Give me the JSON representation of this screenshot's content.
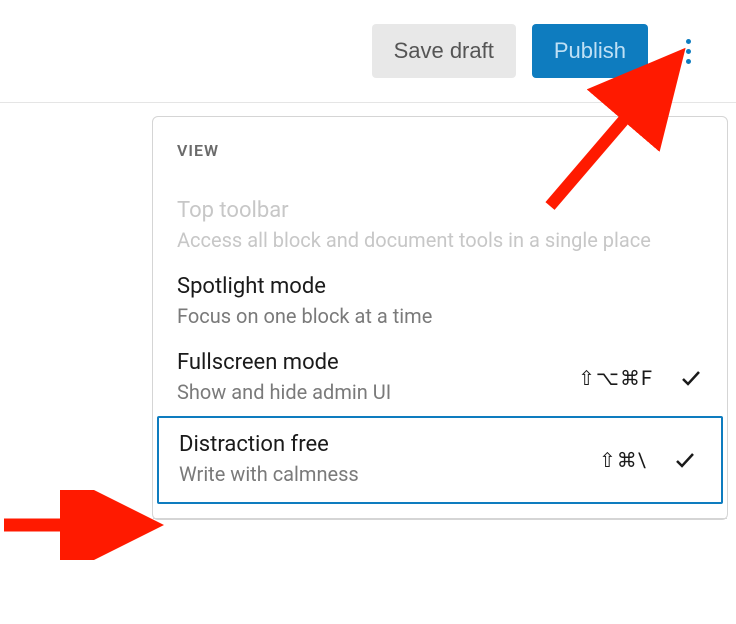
{
  "toolbar": {
    "save_draft_label": "Save draft",
    "publish_label": "Publish"
  },
  "dropdown": {
    "header": "VIEW",
    "items": [
      {
        "title": "Top toolbar",
        "desc": "Access all block and document tools in a single place",
        "shortcut": "",
        "checked": false,
        "disabled": true
      },
      {
        "title": "Spotlight mode",
        "desc": "Focus on one block at a time",
        "shortcut": "",
        "checked": false,
        "disabled": false
      },
      {
        "title": "Fullscreen mode",
        "desc": "Show and hide admin UI",
        "shortcut": "⇧⌥⌘F",
        "checked": true,
        "disabled": false
      },
      {
        "title": "Distraction free",
        "desc": "Write with calmness",
        "shortcut": "⇧⌘\\",
        "checked": true,
        "disabled": false,
        "selected": true
      }
    ]
  }
}
